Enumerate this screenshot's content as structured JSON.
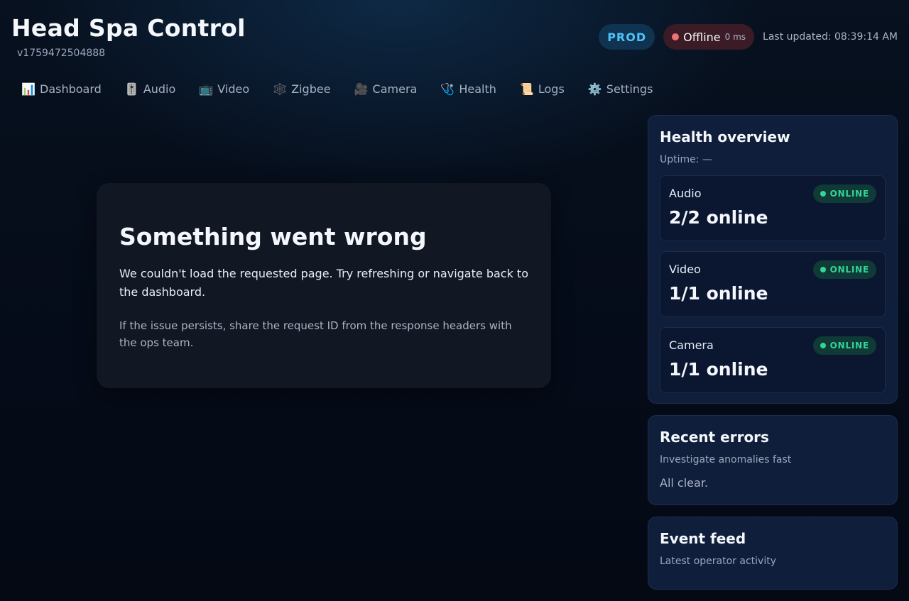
{
  "app": {
    "title": "Head Spa Control",
    "version": "v1759472504888"
  },
  "header": {
    "env_label": "PROD",
    "connection_label": "Offline",
    "connection_latency": "0 ms",
    "last_updated": "Last updated: 08:39:14 AM"
  },
  "nav": [
    {
      "label": "Dashboard",
      "icon": "📊"
    },
    {
      "label": "Audio",
      "icon": "🎚️"
    },
    {
      "label": "Video",
      "icon": "📺"
    },
    {
      "label": "Zigbee",
      "icon": "🕸️"
    },
    {
      "label": "Camera",
      "icon": "🎥"
    },
    {
      "label": "Health",
      "icon": "🩺"
    },
    {
      "label": "Logs",
      "icon": "📜"
    },
    {
      "label": "Settings",
      "icon": "⚙️"
    }
  ],
  "error": {
    "title": "Something went wrong",
    "message": "We couldn't load the requested page. Try refreshing or navigate back to the dashboard.",
    "hint": "If the issue persists, share the request ID from the response headers with the ops team."
  },
  "health": {
    "title": "Health overview",
    "uptime": "Uptime: —",
    "services": [
      {
        "name": "Audio",
        "status": "ONLINE",
        "count": "2/2 online"
      },
      {
        "name": "Video",
        "status": "ONLINE",
        "count": "1/1 online"
      },
      {
        "name": "Camera",
        "status": "ONLINE",
        "count": "1/1 online"
      }
    ]
  },
  "recent_errors": {
    "title": "Recent errors",
    "subtitle": "Investigate anomalies fast",
    "empty": "All clear."
  },
  "event_feed": {
    "title": "Event feed",
    "subtitle": "Latest operator activity"
  },
  "colors": {
    "accent": "#4fc3f7",
    "online": "#34d399",
    "offline": "#f07178"
  }
}
